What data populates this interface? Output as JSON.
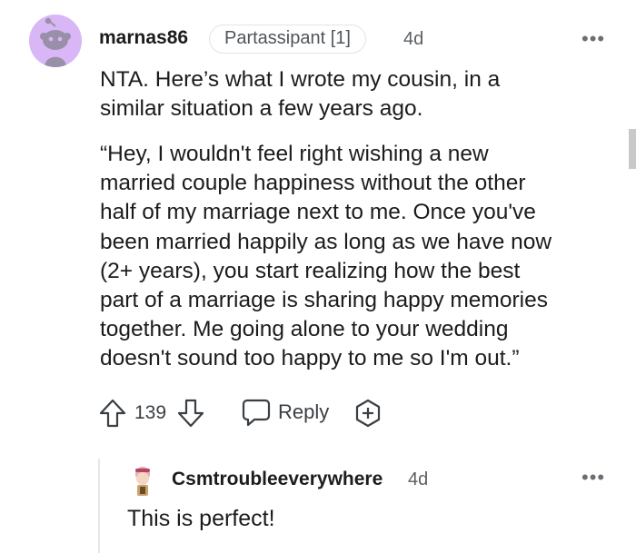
{
  "comment": {
    "username": "marnas86",
    "flair": "Partassipant [1]",
    "timestamp": "4d",
    "more_label": "•••",
    "paragraph1_line1": "NTA. Here’s what I wrote my cousin, in a",
    "paragraph1_line2": "similar situation a few years ago.",
    "paragraph2_lines": [
      "“Hey, I wouldn't feel right wishing a new",
      "married couple happiness without the other",
      "half of my marriage next to me. Once you've",
      "been married happily as long as we have now",
      "(2+ years), you start realizing how the best",
      "part of a marriage is sharing happy memories",
      "together. Me going alone to your wedding",
      "doesn't sound too happy to me so I'm out.”"
    ],
    "votes": "139",
    "reply_label": "Reply"
  },
  "reply": {
    "username": "Csmtroubleeverywhere",
    "timestamp": "4d",
    "more_label": "•••",
    "text": "This is perfect!"
  },
  "icons": {
    "avatar": "snoo-avatar",
    "upvote": "upvote-arrow-icon",
    "downvote": "downvote-arrow-icon",
    "reply": "speech-bubble-icon",
    "award": "award-plus-icon",
    "more": "ellipsis-icon"
  },
  "colors": {
    "avatar_bg": "#d9b7f7",
    "text": "#1c1c1c",
    "meta": "#5a5f64",
    "flair_border": "#e2e3e5"
  }
}
